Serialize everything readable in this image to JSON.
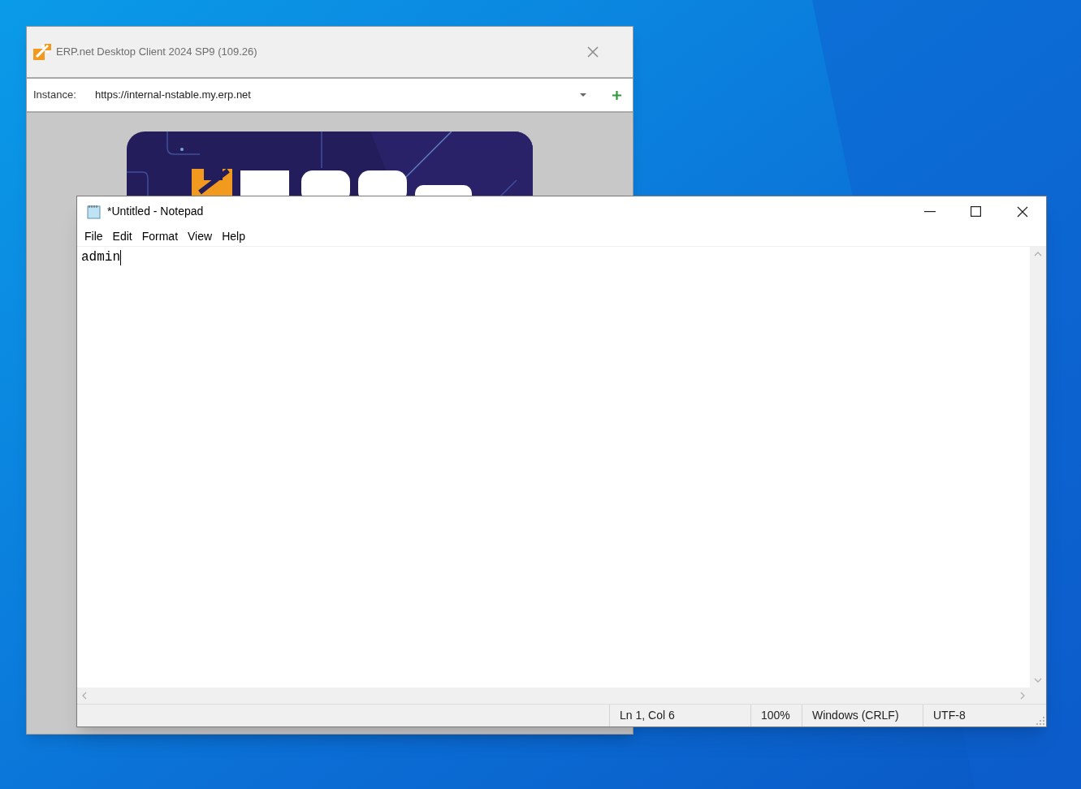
{
  "erp_window": {
    "title": "ERP.net Desktop Client 2024 SP9 (109.26)",
    "instance_label": "Instance:",
    "instance_value": "https://internal-nstable.my.erp.net"
  },
  "notepad": {
    "title": "*Untitled - Notepad",
    "menu": [
      "File",
      "Edit",
      "Format",
      "View",
      "Help"
    ],
    "text": "admin",
    "status_bar": [
      "Ln 1, Col 6",
      "100%",
      "Windows (CRLF)",
      "UTF-8"
    ]
  }
}
